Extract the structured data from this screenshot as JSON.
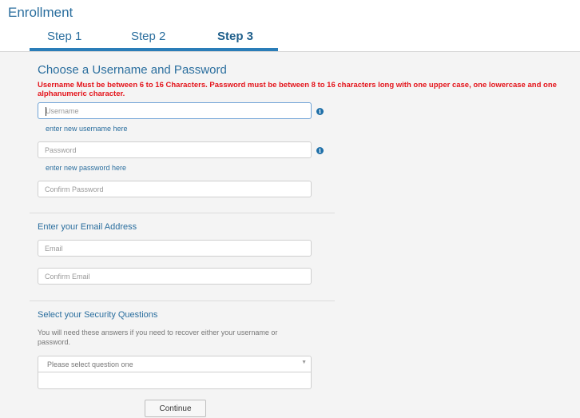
{
  "page": {
    "title": "Enrollment"
  },
  "tabs": [
    {
      "label": "Step 1"
    },
    {
      "label": "Step 2"
    },
    {
      "label": "Step 3",
      "active": true
    }
  ],
  "credentials": {
    "title": "Choose a Username and Password",
    "warning": "Username Must be between 6 to 16 Characters. Password must be between 8 to 16 characters long with one upper case, one lowercase and one alphanumeric character.",
    "username": {
      "placeholder": "Username",
      "hint": "enter new username here",
      "info_icon": "info-icon"
    },
    "password": {
      "placeholder": "Password",
      "hint": "enter new password here",
      "info_icon": "info-icon"
    },
    "confirm_password": {
      "placeholder": "Confirm Password"
    }
  },
  "email": {
    "title": "Enter your Email Address",
    "email": {
      "placeholder": "Email"
    },
    "confirm_email": {
      "placeholder": "Confirm Email"
    }
  },
  "security": {
    "title": "Select your Security Questions",
    "description": "You will need these answers if you need to recover either your username or password.",
    "question_one": {
      "selected": "Please select question one"
    },
    "answer_one": {
      "value": ""
    }
  },
  "actions": {
    "continue_label": "Continue"
  },
  "colors": {
    "accent": "#2a6e9e",
    "warning": "#e4141b",
    "tab_underline": "#2a7db8",
    "panel_bg": "#f4f4f4"
  }
}
